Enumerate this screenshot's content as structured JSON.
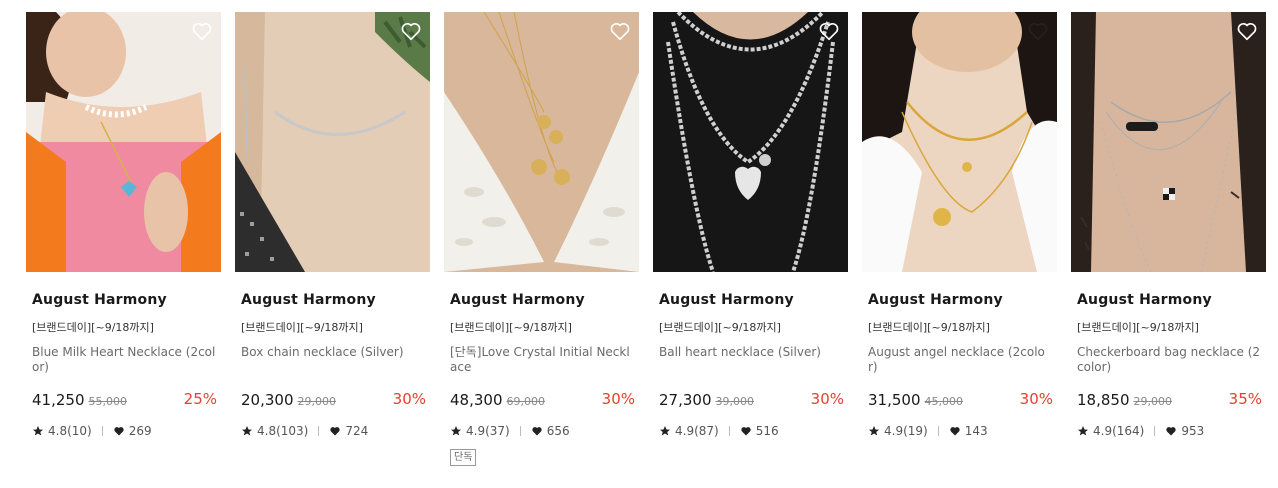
{
  "products": [
    {
      "brand": "August Harmony",
      "promo": "[브랜드데이][~9/18까지]",
      "name": "Blue Milk Heart Necklace (2color)",
      "price": "41,250",
      "original_price": "55,000",
      "discount": "25%",
      "rating": "4.8(10)",
      "likes": "269"
    },
    {
      "brand": "August Harmony",
      "promo": "[브랜드데이][~9/18까지]",
      "name": "Box chain necklace (Silver)",
      "price": "20,300",
      "original_price": "29,000",
      "discount": "30%",
      "rating": "4.8(103)",
      "likes": "724"
    },
    {
      "brand": "August Harmony",
      "promo": "[브랜드데이][~9/18까지]",
      "name": "[단독]Love Crystal Initial Necklace",
      "price": "48,300",
      "original_price": "69,000",
      "discount": "30%",
      "rating": "4.9(37)",
      "likes": "656",
      "tag": "단독"
    },
    {
      "brand": "August Harmony",
      "promo": "[브랜드데이][~9/18까지]",
      "name": "Ball heart necklace (Silver)",
      "price": "27,300",
      "original_price": "39,000",
      "discount": "30%",
      "rating": "4.9(87)",
      "likes": "516"
    },
    {
      "brand": "August Harmony",
      "promo": "[브랜드데이][~9/18까지]",
      "name": "August angel necklace (2color)",
      "price": "31,500",
      "original_price": "45,000",
      "discount": "30%",
      "rating": "4.9(19)",
      "likes": "143"
    },
    {
      "brand": "August Harmony",
      "promo": "[브랜드데이][~9/18까지]",
      "name": "Checkerboard bag necklace (2color)",
      "price": "18,850",
      "original_price": "29,000",
      "discount": "35%",
      "rating": "4.9(164)",
      "likes": "953"
    }
  ],
  "icons": {
    "wishlist": "heart-outline-icon",
    "rating": "star-icon",
    "likes": "heart-filled-icon"
  },
  "colors": {
    "discount": "#e4402f",
    "text_primary": "#1a1a1a",
    "text_secondary": "#6a6a6a"
  }
}
